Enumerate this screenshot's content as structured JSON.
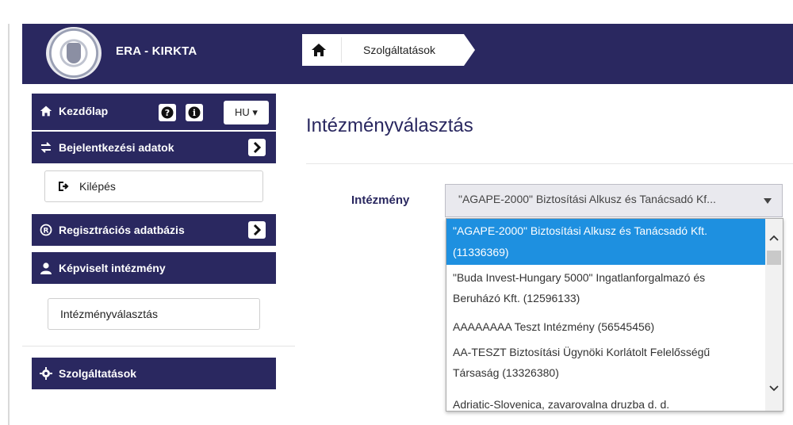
{
  "header": {
    "app_title": "ERA - KIRKTA",
    "breadcrumb": {
      "home_icon": "home-icon",
      "current": "Szolgáltatások"
    },
    "colors": {
      "navy": "#2a2860",
      "highlight": "#1e90e0"
    }
  },
  "sidebar": {
    "home": {
      "label": "Kezdőlap",
      "icon": "home-icon",
      "help_icon": "question-circle-icon",
      "info_icon": "info-circle-icon",
      "lang": "HU ▾"
    },
    "login_data": {
      "label": "Bejelentkezési adatok",
      "icon": "exchange-icon",
      "toggle_icon": "chevron-right-icon"
    },
    "logout": {
      "label": "Kilépés",
      "icon": "sign-out-icon"
    },
    "registry": {
      "label": "Regisztrációs adatbázis",
      "icon": "registered-icon",
      "toggle_icon": "chevron-right-icon"
    },
    "represented": {
      "label": "Képviselt intézmény",
      "icon": "user-icon"
    },
    "institution_select": {
      "label": "Intézményválasztás"
    },
    "services": {
      "label": "Szolgáltatások",
      "icon": "cog-icon"
    }
  },
  "main": {
    "title": "Intézményválasztás",
    "field_label": "Intézmény",
    "selected_value": "\"AGAPE-2000\" Biztosítási Alkusz és Tanácsadó Kf...",
    "options": [
      {
        "line1": "\"AGAPE-2000\" Biztosítási Alkusz és Tanácsadó Kft.",
        "line2": "(11336369)"
      },
      {
        "line1": "\"Buda Invest-Hungary 5000\" Ingatlanforgalmazó és",
        "line2": "Beruházó Kft. (12596133)"
      },
      {
        "line1": "AAAAAAAA Teszt Intézmény (56545456)",
        "line2": ""
      },
      {
        "line1": "AA-TESZT Biztosítási Ügynöki Korlátolt Felelősségű",
        "line2": "Társaság (13326380)"
      },
      {
        "line1": "Adriatic-Slovenica, zavarovalna druzba d. d.",
        "line2": ""
      }
    ]
  }
}
